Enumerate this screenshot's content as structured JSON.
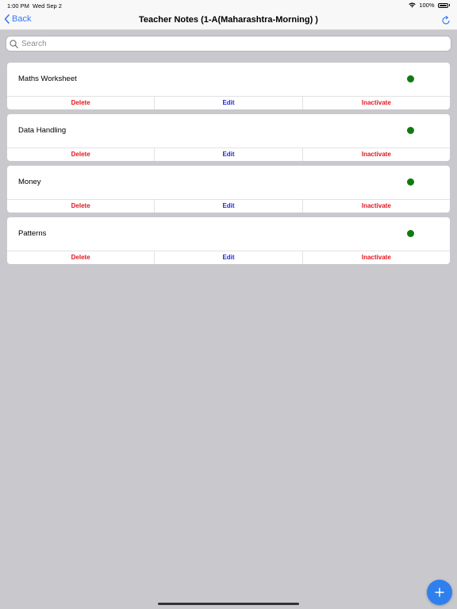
{
  "status_bar": {
    "time": "1:00 PM",
    "date": "Wed Sep 2",
    "battery": "100%"
  },
  "nav": {
    "back_label": "Back",
    "title": "Teacher Notes (1-A(Maharashtra-Morning) )"
  },
  "search": {
    "placeholder": "Search",
    "value": ""
  },
  "notes": [
    {
      "title": "Maths Worksheet",
      "status_color": "#0f7a0f"
    },
    {
      "title": "Data Handling",
      "status_color": "#0f7a0f"
    },
    {
      "title": "Money",
      "status_color": "#0f7a0f"
    },
    {
      "title": "Patterns",
      "status_color": "#0f7a0f"
    }
  ],
  "actions": {
    "delete": "Delete",
    "edit": "Edit",
    "inactivate": "Inactivate"
  },
  "icons": {
    "back": "chevron-left-icon",
    "refresh": "refresh-icon",
    "search": "search-icon",
    "wifi": "wifi-icon",
    "battery": "battery-icon",
    "add": "plus-icon"
  },
  "colors": {
    "accent": "#3478f6",
    "danger": "#e3161e",
    "edit": "#1e2bd6",
    "fab": "#2f80ed",
    "active": "#0f7a0f"
  }
}
